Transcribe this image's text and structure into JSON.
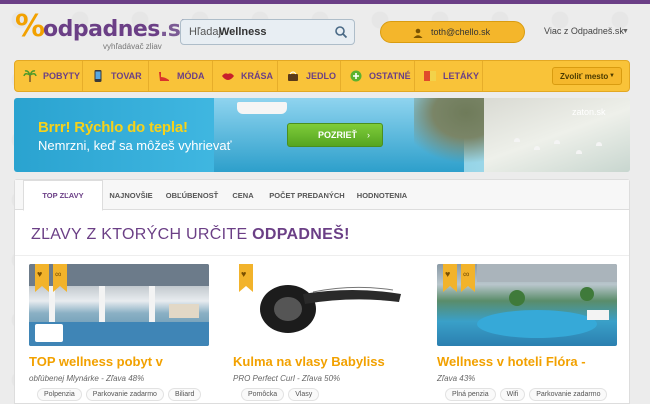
{
  "brand": {
    "name": "odpadnes",
    "tld": ".sk",
    "tagline": "vyhľadávač zliav"
  },
  "search": {
    "label": "Hľadaj",
    "value": "Wellness"
  },
  "user": {
    "email": "toth@chello.sk"
  },
  "more_link": "Viac z Odpadneš.sk",
  "nav": [
    {
      "label": "POBYTY",
      "icon": "palm-icon"
    },
    {
      "label": "TOVAR",
      "icon": "phone-icon"
    },
    {
      "label": "MÓDA",
      "icon": "shoe-icon"
    },
    {
      "label": "KRÁSA",
      "icon": "lips-icon"
    },
    {
      "label": "JEDLO",
      "icon": "food-icon"
    },
    {
      "label": "OSTATNÉ",
      "icon": "plus-icon"
    },
    {
      "label": "LETÁKY",
      "icon": "flyer-icon"
    }
  ],
  "city_select": "Zvoliť mesto",
  "banner": {
    "title": "Brrr! Rýchlo do tepla!",
    "subtitle": "Nemrzni, keď sa môžeš vyhrievať",
    "button": "POZRIEŤ",
    "place": "zaton.sk"
  },
  "tabs": [
    "TOP ZĽAVY",
    "NAJNOVŠIE",
    "OBĽÚBENOSŤ",
    "CENA",
    "POČET PREDANÝCH",
    "HODNOTENIA"
  ],
  "heading": {
    "prefix": "ZĽAVY Z KTORÝCH URČITE",
    "emph": "ODPADNEŠ!"
  },
  "cards": [
    {
      "title": "TOP wellness pobyt v",
      "desc": "obľúbenej Mlynárke - Zľava 48%",
      "tags": [
        "Polpenzia",
        "Parkovanie zadarmo",
        "Biliard"
      ],
      "logo": "penzión Mlynárka"
    },
    {
      "title": "Kulma na vlasy Babyliss",
      "desc": "PRO Perfect Curl - Zľava 50%",
      "tags": [
        "Pomôcka",
        "Vlasy"
      ]
    },
    {
      "title": "Wellness v hoteli Flóra -",
      "desc": "Zľava 43%",
      "tags": [
        "Plná penzia",
        "Wifi",
        "Parkovanie zadarmo"
      ]
    }
  ],
  "colors": {
    "purple": "#6b3f86",
    "yellow": "#f9c339",
    "orange_text": "#f2a100",
    "green_button": "#55a521"
  }
}
